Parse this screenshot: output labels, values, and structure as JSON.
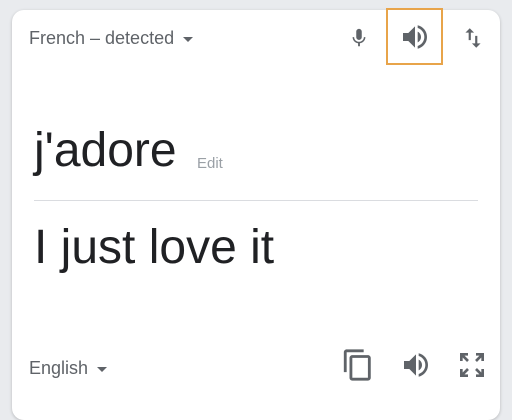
{
  "source": {
    "language_label": "French – detected",
    "text": "j'adore",
    "edit_label": "Edit"
  },
  "target": {
    "language_label": "English",
    "text": "I just love it"
  },
  "icons": {
    "mic": "microphone-icon",
    "speaker": "speaker-icon",
    "swap": "swap-languages-icon",
    "copy": "copy-icon",
    "fullscreen": "fullscreen-icon"
  },
  "colors": {
    "focus_outline": "#e8a44a",
    "text_primary": "#202124",
    "text_secondary": "#5f6368"
  }
}
